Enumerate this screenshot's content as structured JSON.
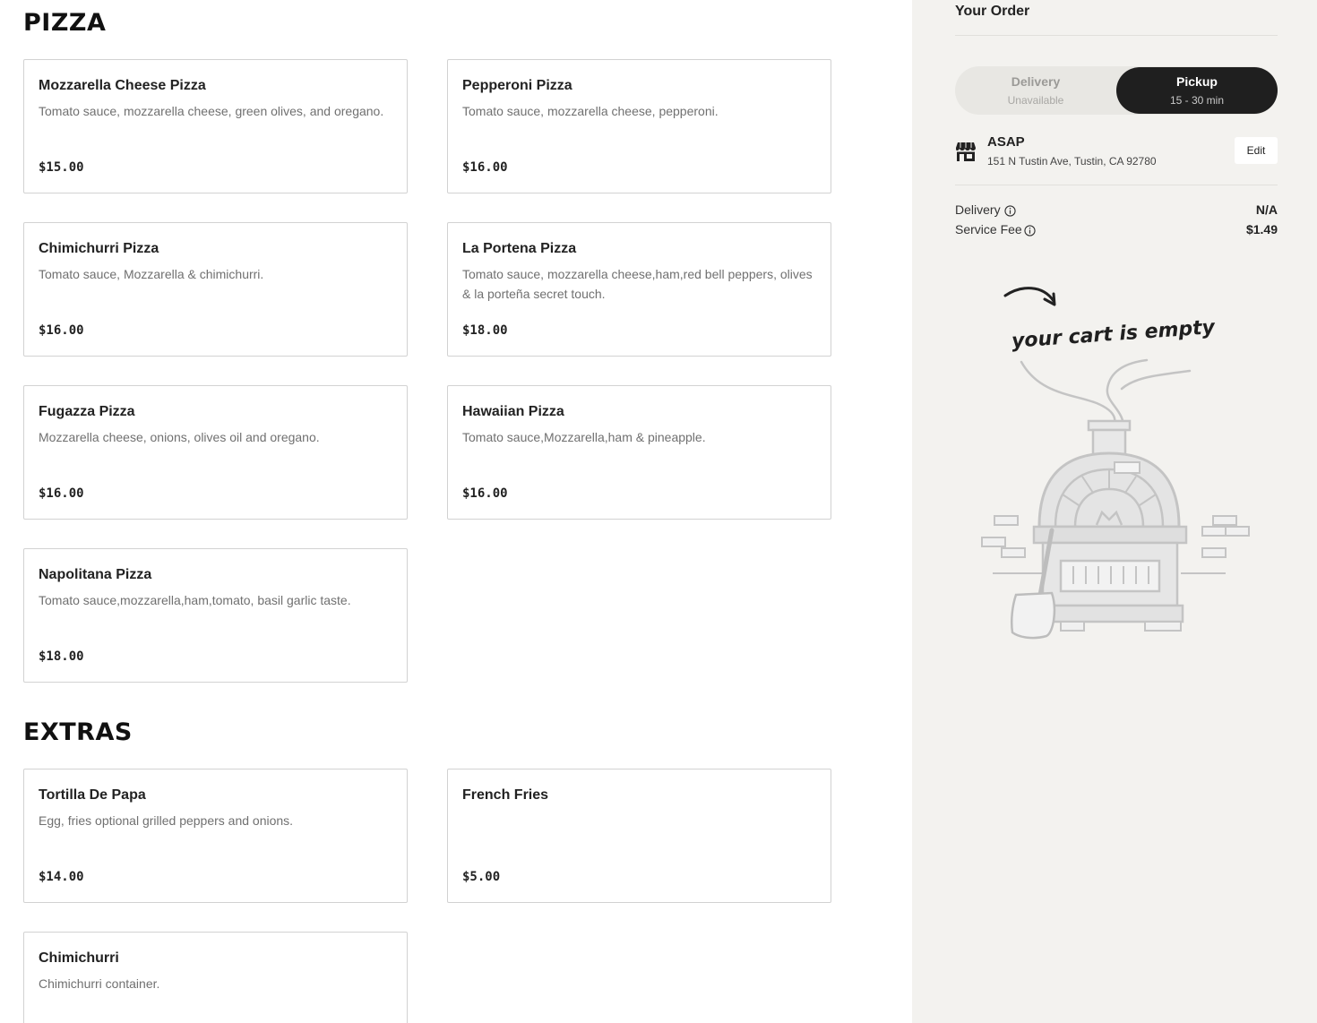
{
  "menu": {
    "sections": [
      {
        "title": "PIZZA",
        "items": [
          {
            "name": "Mozzarella Cheese Pizza",
            "desc": "Tomato sauce, mozzarella cheese, green olives, and oregano.",
            "price": "$15.00"
          },
          {
            "name": "Pepperoni Pizza",
            "desc": "Tomato sauce, mozzarella cheese, pepperoni.",
            "price": "$16.00"
          },
          {
            "name": "Chimichurri Pizza",
            "desc": "Tomato sauce, Mozzarella & chimichurri.",
            "price": "$16.00"
          },
          {
            "name": "La Portena Pizza",
            "desc": "Tomato sauce, mozzarella cheese,ham,red bell peppers, olives & la porteña secret touch.",
            "price": "$18.00"
          },
          {
            "name": "Fugazza Pizza",
            "desc": "Mozzarella cheese, onions, olives oil and oregano.",
            "price": "$16.00"
          },
          {
            "name": "Hawaiian Pizza",
            "desc": "Tomato sauce,Mozzarella,ham & pineapple.",
            "price": "$16.00"
          },
          {
            "name": "Napolitana Pizza",
            "desc": "Tomato sauce,mozzarella,ham,tomato, basil garlic taste.",
            "price": "$18.00"
          }
        ]
      },
      {
        "title": "EXTRAS",
        "items": [
          {
            "name": "Tortilla De Papa",
            "desc": "Egg, fries optional grilled peppers and onions.",
            "price": "$14.00"
          },
          {
            "name": "French Fries",
            "desc": "",
            "price": "$5.00"
          },
          {
            "name": "Chimichurri",
            "desc": "Chimichurri container.",
            "price": ""
          }
        ]
      }
    ]
  },
  "order": {
    "title": "Your Order",
    "toggle": {
      "delivery_label": "Delivery",
      "delivery_sub": "Unavailable",
      "pickup_label": "Pickup",
      "pickup_sub": "15 - 30 min"
    },
    "store_icon": "store-icon",
    "time": "ASAP",
    "address": "151 N Tustin Ave, Tustin, CA 92780",
    "edit_label": "Edit",
    "fees": [
      {
        "label": "Delivery",
        "value": "N/A"
      },
      {
        "label": "Service Fee",
        "value": "$1.49"
      }
    ],
    "empty_text": "your cart is empty"
  },
  "colors": {
    "sidebar_bg": "#f3f2ef",
    "toggle_active": "#1f1f1f",
    "card_border": "#d2d2d2",
    "illustration_stroke": "#c4c4c4"
  }
}
